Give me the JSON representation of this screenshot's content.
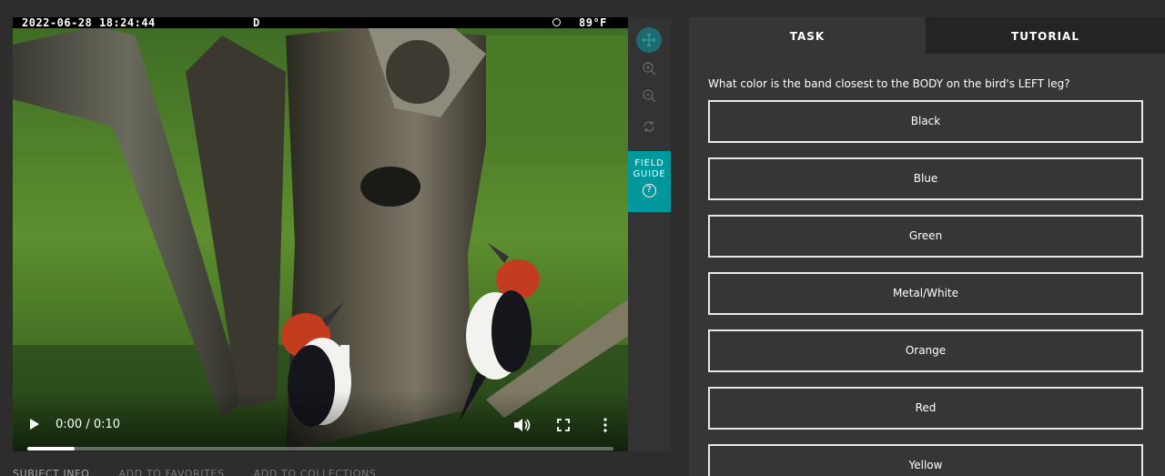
{
  "video": {
    "timestamp": "2022-06-28 18:24:44",
    "day_flag": "D",
    "temperature": "89°F",
    "time_display": "0:00 / 0:10",
    "progress_fraction": 0.08
  },
  "toolbar": {
    "icons": [
      "move-icon",
      "zoom-in-icon",
      "zoom-out-icon",
      "rotate-icon"
    ],
    "field_guide_line1": "FIELD",
    "field_guide_line2": "GUIDE",
    "field_guide_icon": "?"
  },
  "subject_links": {
    "info": "SUBJECT INFO",
    "favorites": "ADD TO FAVORITES",
    "collections": "ADD TO COLLECTIONS"
  },
  "tabs": {
    "task": "TASK",
    "tutorial": "TUTORIAL"
  },
  "task": {
    "question": "What color is the band closest to the BODY on the bird's LEFT leg?",
    "answers": [
      "Black",
      "Blue",
      "Green",
      "Metal/White",
      "Orange",
      "Red",
      "Yellow"
    ]
  },
  "colors": {
    "accent": "#00979d",
    "background": "#2d2d2d",
    "panel": "#363636"
  }
}
